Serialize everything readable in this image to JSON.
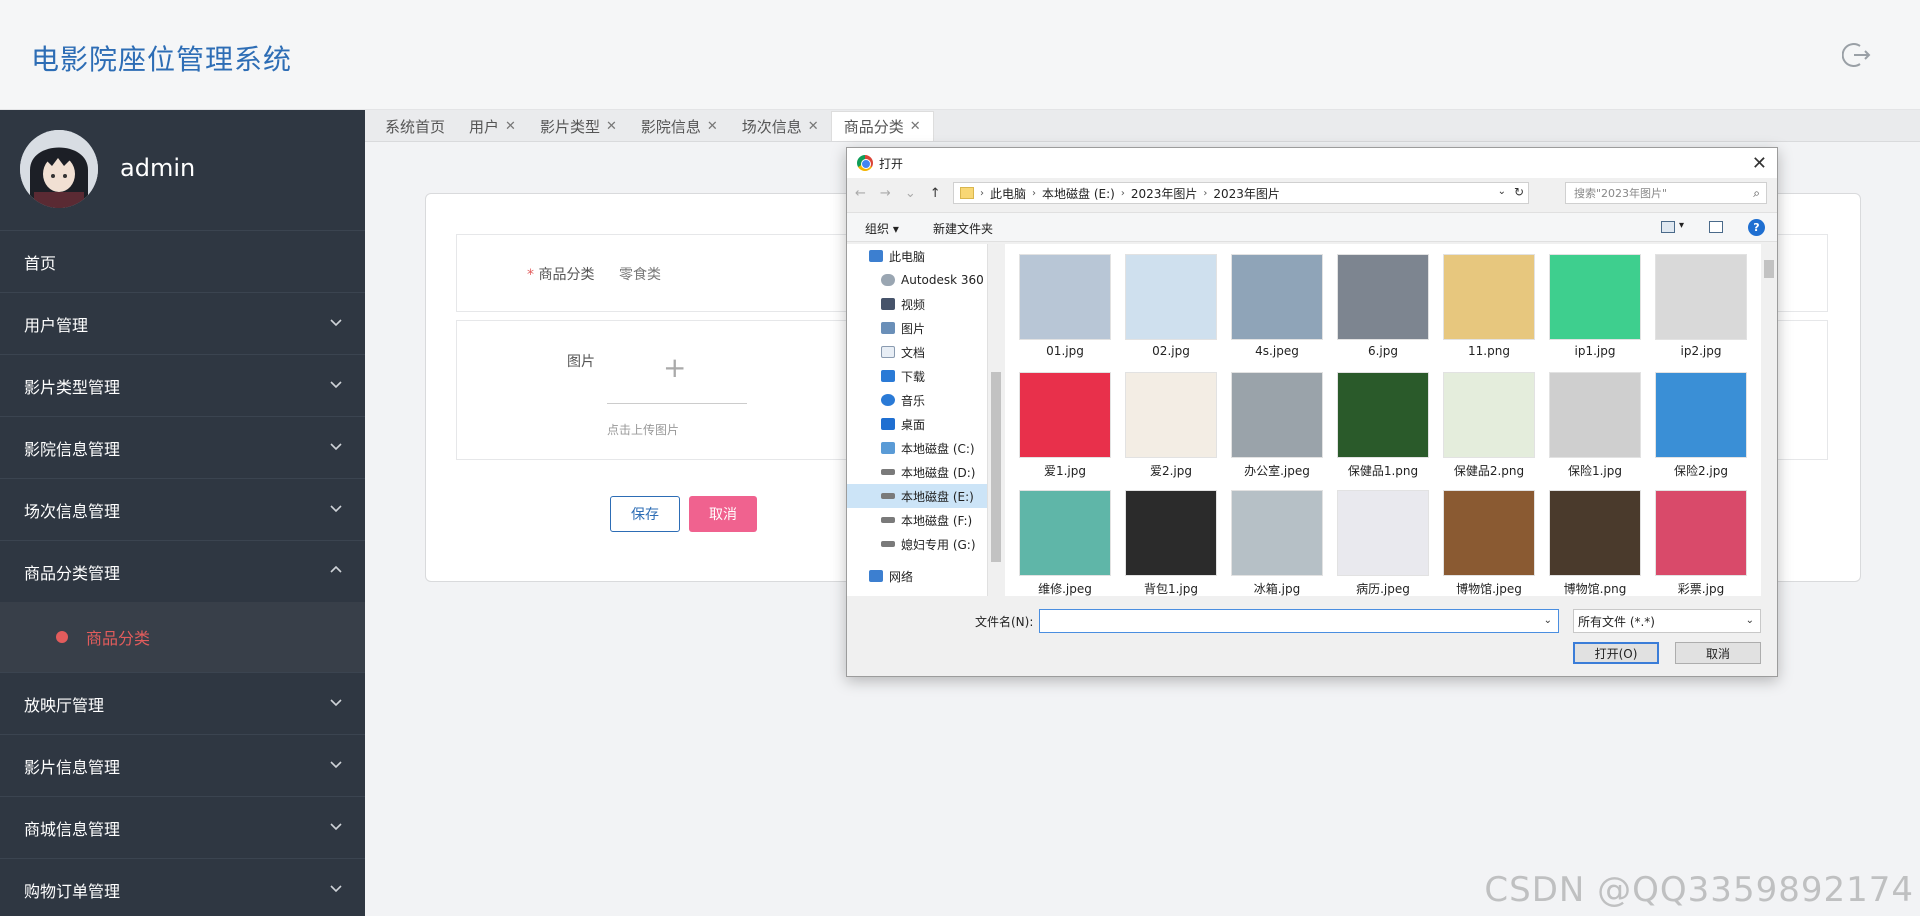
{
  "app": {
    "title": "电影院座位管理系统"
  },
  "user": {
    "name": "admin"
  },
  "sidebar": {
    "items": [
      {
        "label": "首页",
        "has_children": false
      },
      {
        "label": "用户管理",
        "has_children": true
      },
      {
        "label": "影片类型管理",
        "has_children": true
      },
      {
        "label": "影院信息管理",
        "has_children": true
      },
      {
        "label": "场次信息管理",
        "has_children": true
      },
      {
        "label": "商品分类管理",
        "has_children": true,
        "expanded": true
      },
      {
        "label": "放映厅管理",
        "has_children": true
      },
      {
        "label": "影片信息管理",
        "has_children": true
      },
      {
        "label": "商城信息管理",
        "has_children": true
      },
      {
        "label": "购物订单管理",
        "has_children": true
      }
    ],
    "subitem": {
      "label": "商品分类",
      "active_color": "#e25c5c"
    }
  },
  "tabs": [
    {
      "label": "系统首页",
      "closable": false
    },
    {
      "label": "用户",
      "closable": true
    },
    {
      "label": "影片类型",
      "closable": true
    },
    {
      "label": "影院信息",
      "closable": true
    },
    {
      "label": "场次信息",
      "closable": true
    },
    {
      "label": "商品分类",
      "closable": true,
      "active": true
    }
  ],
  "form": {
    "category_label": "商品分类",
    "required_mark": "*",
    "category_value": "零食类",
    "image_label": "图片",
    "upload_plus": "+",
    "upload_hint": "点击上传图片",
    "save_label": "保存",
    "cancel_label": "取消"
  },
  "dialog": {
    "title": "打开",
    "close": "✕",
    "breadcrumb": [
      "此电脑",
      "本地磁盘 (E:)",
      "2023年图片",
      "2023年图片"
    ],
    "search_placeholder": "搜索\"2023年图片\"",
    "toolbar": {
      "organize": "组织 ▾",
      "new_folder": "新建文件夹",
      "help": "?"
    },
    "tree": [
      {
        "label": "此电脑",
        "icon": "computer-icon",
        "top": true
      },
      {
        "label": "Autodesk 360",
        "icon": "cloud-icon"
      },
      {
        "label": "视频",
        "icon": "video-icon"
      },
      {
        "label": "图片",
        "icon": "picture-icon"
      },
      {
        "label": "文档",
        "icon": "document-icon"
      },
      {
        "label": "下载",
        "icon": "download-icon"
      },
      {
        "label": "音乐",
        "icon": "music-icon"
      },
      {
        "label": "桌面",
        "icon": "desktop-icon"
      },
      {
        "label": "本地磁盘 (C:)",
        "icon": "drive-icon"
      },
      {
        "label": "本地磁盘 (D:)",
        "icon": "drive-icon"
      },
      {
        "label": "本地磁盘 (E:)",
        "icon": "drive-icon",
        "selected": true
      },
      {
        "label": "本地磁盘 (F:)",
        "icon": "drive-icon"
      },
      {
        "label": "媳妇专用 (G:)",
        "icon": "drive-icon"
      },
      {
        "label": "网络",
        "icon": "network-icon",
        "top": true
      }
    ],
    "files": [
      {
        "name": "01.jpg",
        "color": "#b8c6d6"
      },
      {
        "name": "02.jpg",
        "color": "#cfe0ee"
      },
      {
        "name": "4s.jpeg",
        "color": "#8fa4b8"
      },
      {
        "name": "6.jpg",
        "color": "#7d8590"
      },
      {
        "name": "11.png",
        "color": "#e7c77e"
      },
      {
        "name": "ip1.jpg",
        "color": "#3ecf8e"
      },
      {
        "name": "ip2.jpg",
        "color": "#d9d9d9"
      },
      {
        "name": "爱1.jpg",
        "color": "#e8304b"
      },
      {
        "name": "爱2.jpg",
        "color": "#f3ede4"
      },
      {
        "name": "办公室.jpeg",
        "color": "#9aa3aa"
      },
      {
        "name": "保健品1.png",
        "color": "#2a5a2a"
      },
      {
        "name": "保健品2.png",
        "color": "#e4eddc"
      },
      {
        "name": "保险1.jpg",
        "color": "#cfcfcf"
      },
      {
        "name": "保险2.jpg",
        "color": "#3a8fd6"
      },
      {
        "name": "维修.jpeg",
        "color": "#5fb6a8"
      },
      {
        "name": "背包1.jpg",
        "color": "#2b2b2b"
      },
      {
        "name": "冰箱.jpg",
        "color": "#b6c0c6"
      },
      {
        "name": "病历.jpeg",
        "color": "#e9e9ee"
      },
      {
        "name": "博物馆.jpeg",
        "color": "#8a5a32"
      },
      {
        "name": "博物馆.png",
        "color": "#4a3a2c"
      },
      {
        "name": "彩票.jpg",
        "color": "#d94a6a"
      }
    ],
    "filename_label": "文件名(N):",
    "filename_value": "",
    "filetype": "所有文件 (*.*)",
    "open_label": "打开(O)",
    "cancel_label": "取消"
  },
  "watermark": "CSDN @QQ3359892174"
}
